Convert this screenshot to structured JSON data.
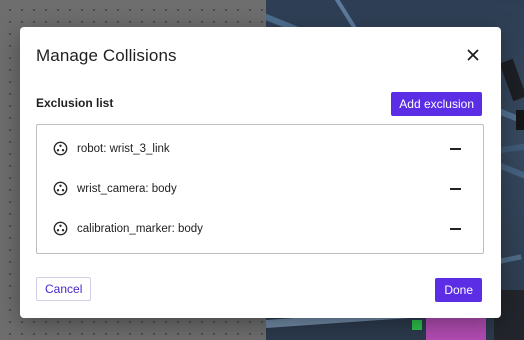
{
  "modal": {
    "title": "Manage Collisions",
    "close_icon": "close-icon",
    "section_label": "Exclusion list",
    "add_button_label": "Add exclusion",
    "items": [
      {
        "label": "robot: wrist_3_link",
        "icon": "link-node-icon"
      },
      {
        "label": "wrist_camera: body",
        "icon": "link-node-icon"
      },
      {
        "label": "calibration_marker: body",
        "icon": "link-node-icon"
      }
    ],
    "remove_icon": "minus-icon",
    "cancel_label": "Cancel",
    "done_label": "Done"
  },
  "colors": {
    "accent": "#5b2ee6",
    "modal_bg": "#ffffff",
    "list_border": "#bdbdbd"
  }
}
